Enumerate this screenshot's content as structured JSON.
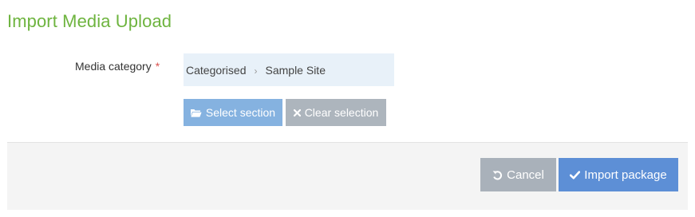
{
  "page": {
    "title": "Import Media Upload"
  },
  "form": {
    "media_category": {
      "label": "Media category",
      "required_marker": "*",
      "breadcrumb": [
        "Categorised",
        "Sample Site"
      ],
      "separator": "›"
    },
    "select_section_label": "Select section",
    "clear_selection_label": "Clear selection"
  },
  "footer": {
    "cancel_label": "Cancel",
    "import_label": "Import package"
  },
  "icons": {
    "select_section": "folder-open-icon",
    "clear_selection": "times-icon",
    "cancel": "undo-icon",
    "import": "check-icon"
  },
  "colors": {
    "title": "#6eb43f",
    "required": "#d9534f",
    "crumb_bg": "#e8f1f9",
    "select_button": "#85b2e0",
    "clear_button": "#adb5bd",
    "cancel_button": "#a9b1ba",
    "import_button": "#5d8fd6"
  }
}
